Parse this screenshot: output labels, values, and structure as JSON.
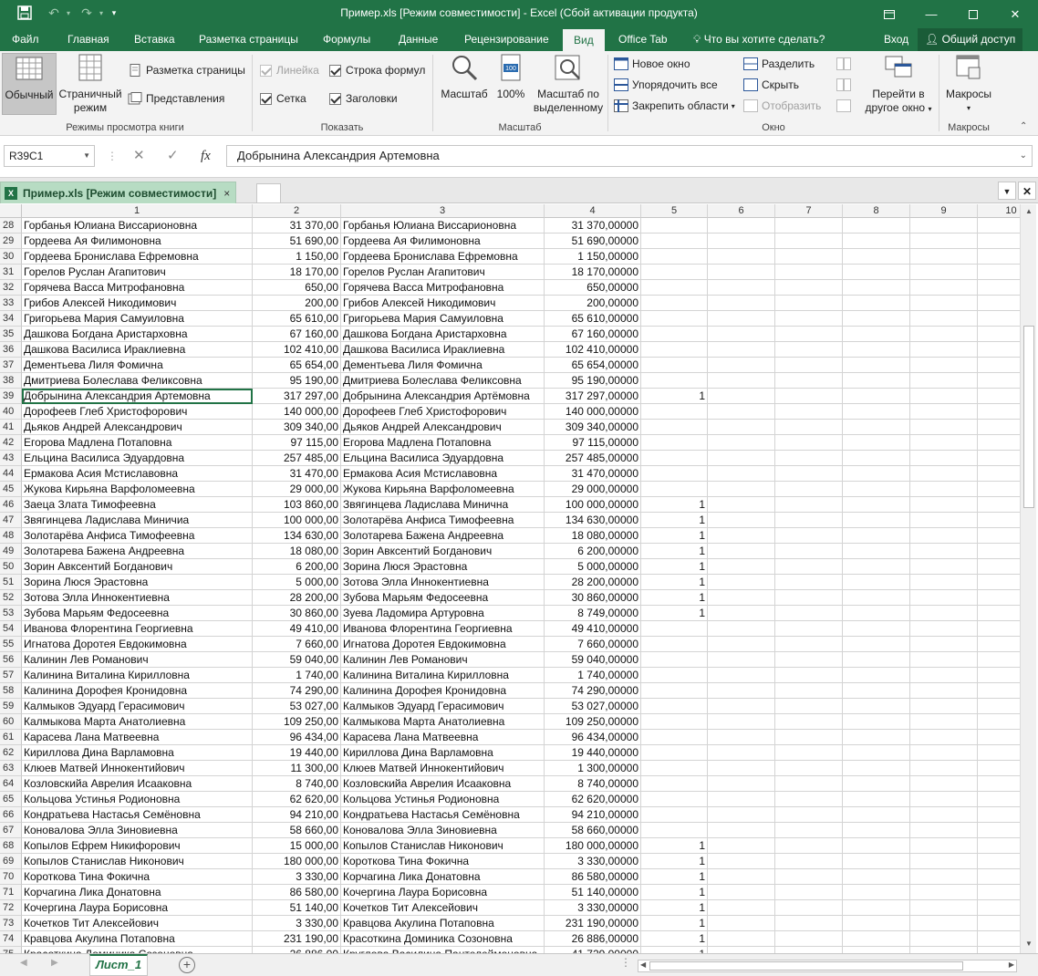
{
  "title_bar": {
    "title": "Пример.xls  [Режим совместимости] - Excel (Сбой активации продукта)",
    "save_icon": "save-icon",
    "undo_icon": "undo-icon",
    "redo_icon": "redo-icon",
    "qat_customize_icon": "chevron-down-icon"
  },
  "ribbon_tabs": {
    "tabs": [
      "Файл",
      "Главная",
      "Вставка",
      "Разметка страницы",
      "Формулы",
      "Данные",
      "Рецензирование",
      "Вид",
      "Office Tab"
    ],
    "active": "Вид",
    "tell_me": "Что вы хотите сделать?",
    "sign_in": "Вход",
    "share": "Общий доступ"
  },
  "ribbon": {
    "view_modes": {
      "normal": "Обычный",
      "page_break_line1": "Страничный",
      "page_break_line2": "режим",
      "page_layout": "Разметка страницы",
      "custom_views": "Представления",
      "group_label": "Режимы просмотра книги"
    },
    "show": {
      "ruler": "Линейка",
      "formula_bar": "Строка формул",
      "gridlines": "Сетка",
      "headings": "Заголовки",
      "group_label": "Показать"
    },
    "zoom": {
      "zoom": "Масштаб",
      "hundred": "100%",
      "zoom_to_sel_line1": "Масштаб по",
      "zoom_to_sel_line2": "выделенному",
      "group_label": "Масштаб"
    },
    "window": {
      "new_window": "Новое окно",
      "arrange_all": "Упорядочить все",
      "freeze_panes": "Закрепить области",
      "split": "Разделить",
      "hide": "Скрыть",
      "unhide": "Отобразить",
      "switch_line1": "Перейти в",
      "switch_line2": "другое окно",
      "group_label": "Окно"
    },
    "macros": {
      "macros": "Макросы",
      "group_label": "Макросы"
    }
  },
  "formula_bar": {
    "name_box": "R39C1",
    "cancel": "✕",
    "enter": "✓",
    "fx": "fx",
    "content": "Добрынина Александрия Артемовна"
  },
  "workbook_tab": {
    "label": "Пример.xls  [Режим совместимости]",
    "close": "×"
  },
  "grid": {
    "columns": [
      "1",
      "2",
      "3",
      "4",
      "5",
      "6",
      "7",
      "8",
      "9",
      "10"
    ],
    "selected_row": "39",
    "rows": [
      {
        "r": "28",
        "c1": "Горбанья Юлиана Виссарионовна",
        "c2": "31 370,00",
        "c3": "Горбанья Юлиана Виссарионовна",
        "c4": "31 370,00000",
        "c5": ""
      },
      {
        "r": "29",
        "c1": "Гордеева Ая Филимоновна",
        "c2": "51 690,00",
        "c3": "Гордеева Ая Филимоновна",
        "c4": "51 690,00000",
        "c5": ""
      },
      {
        "r": "30",
        "c1": "Гордеева Бронислава Ефремовна",
        "c2": "1 150,00",
        "c3": "Гордеева Бронислава Ефремовна",
        "c4": "1 150,00000",
        "c5": ""
      },
      {
        "r": "31",
        "c1": "Горелов Руслан Агапитович",
        "c2": "18 170,00",
        "c3": "Горелов Руслан Агапитович",
        "c4": "18 170,00000",
        "c5": ""
      },
      {
        "r": "32",
        "c1": "Горячева Васса Митрофановна",
        "c2": "650,00",
        "c3": "Горячева Васса Митрофановна",
        "c4": "650,00000",
        "c5": ""
      },
      {
        "r": "33",
        "c1": "Грибов Алексей Никодимович",
        "c2": "200,00",
        "c3": "Грибов Алексей Никодимович",
        "c4": "200,00000",
        "c5": ""
      },
      {
        "r": "34",
        "c1": "Григорьева Мария Самуиловна",
        "c2": "65 610,00",
        "c3": "Григорьева Мария Самуиловна",
        "c4": "65 610,00000",
        "c5": ""
      },
      {
        "r": "35",
        "c1": "Дашкова Богдана Аристарховна",
        "c2": "67 160,00",
        "c3": "Дашкова Богдана Аристарховна",
        "c4": "67 160,00000",
        "c5": ""
      },
      {
        "r": "36",
        "c1": "Дашкова Василиса Ираклиевна",
        "c2": "102 410,00",
        "c3": "Дашкова Василиса Ираклиевна",
        "c4": "102 410,00000",
        "c5": ""
      },
      {
        "r": "37",
        "c1": "Дементьева Лиля Фомична",
        "c2": "65 654,00",
        "c3": "Дементьева Лиля Фомична",
        "c4": "65 654,00000",
        "c5": ""
      },
      {
        "r": "38",
        "c1": "Дмитриева Болеслава Феликсовна",
        "c2": "95 190,00",
        "c3": "Дмитриева Болеслава Феликсовна",
        "c4": "95 190,00000",
        "c5": ""
      },
      {
        "r": "39",
        "c1": "Добрынина Александрия Артемовна",
        "c2": "317 297,00",
        "c3": "Добрынина Александрия Артёмовна",
        "c4": "317 297,00000",
        "c5": "1"
      },
      {
        "r": "40",
        "c1": "Дорофеев Глеб Христофорович",
        "c2": "140 000,00",
        "c3": "Дорофеев Глеб Христофорович",
        "c4": "140 000,00000",
        "c5": ""
      },
      {
        "r": "41",
        "c1": "Дьяков Андрей Александрович",
        "c2": "309 340,00",
        "c3": "Дьяков Андрей Александрович",
        "c4": "309 340,00000",
        "c5": ""
      },
      {
        "r": "42",
        "c1": "Егорова Мадлена Потаповна",
        "c2": "97 115,00",
        "c3": "Егорова Мадлена Потаповна",
        "c4": "97 115,00000",
        "c5": ""
      },
      {
        "r": "43",
        "c1": "Ельцина Василиса Эдуардовна",
        "c2": "257 485,00",
        "c3": "Ельцина Василиса Эдуардовна",
        "c4": "257 485,00000",
        "c5": ""
      },
      {
        "r": "44",
        "c1": "Ермакова Асия Мстиславовна",
        "c2": "31 470,00",
        "c3": "Ермакова Асия Мстиславовна",
        "c4": "31 470,00000",
        "c5": ""
      },
      {
        "r": "45",
        "c1": "Жукова Кирьяна Варфоломеевна",
        "c2": "29 000,00",
        "c3": "Жукова Кирьяна Варфоломеевна",
        "c4": "29 000,00000",
        "c5": ""
      },
      {
        "r": "46",
        "c1": "Заеца Злата Тимофеевна",
        "c2": "103 860,00",
        "c3": "Звягинцева Ладислава Минична",
        "c4": "100 000,00000",
        "c5": "1"
      },
      {
        "r": "47",
        "c1": "Звягинцева Ладислава Миничиа",
        "c2": "100 000,00",
        "c3": "Золотарёва Анфиса Тимофеевна",
        "c4": "134 630,00000",
        "c5": "1"
      },
      {
        "r": "48",
        "c1": "Золотарёва Анфиса Тимофеевна",
        "c2": "134 630,00",
        "c3": "Золотарева Бажена Андреевна",
        "c4": "18 080,00000",
        "c5": "1"
      },
      {
        "r": "49",
        "c1": "Золотарева Бажена Андреевна",
        "c2": "18 080,00",
        "c3": "Зорин Авксентий Богданович",
        "c4": "6 200,00000",
        "c5": "1"
      },
      {
        "r": "50",
        "c1": "Зорин Авксентий Богданович",
        "c2": "6 200,00",
        "c3": "Зорина Люся Эрастовна",
        "c4": "5 000,00000",
        "c5": "1"
      },
      {
        "r": "51",
        "c1": "Зорина Люся Эрастовна",
        "c2": "5 000,00",
        "c3": "Зотова Элла Иннокентиевна",
        "c4": "28 200,00000",
        "c5": "1"
      },
      {
        "r": "52",
        "c1": "Зотова Элла Иннокентиевна",
        "c2": "28 200,00",
        "c3": "Зубова Марьям Федосеевна",
        "c4": "30 860,00000",
        "c5": "1"
      },
      {
        "r": "53",
        "c1": "Зубова Марьям Федосеевна",
        "c2": "30 860,00",
        "c3": "Зуева Ладомира Артуровна",
        "c4": "8 749,00000",
        "c5": "1"
      },
      {
        "r": "54",
        "c1": "Иванова Флорентина Георгиевна",
        "c2": "49 410,00",
        "c3": "Иванова Флорентина Георгиевна",
        "c4": "49 410,00000",
        "c5": ""
      },
      {
        "r": "55",
        "c1": "Игнатова Доротея Евдокимовна",
        "c2": "7 660,00",
        "c3": "Игнатова Доротея Евдокимовна",
        "c4": "7 660,00000",
        "c5": ""
      },
      {
        "r": "56",
        "c1": "Калинин Лев Романович",
        "c2": "59 040,00",
        "c3": "Калинин Лев Романович",
        "c4": "59 040,00000",
        "c5": ""
      },
      {
        "r": "57",
        "c1": "Калинина Виталина Кирилловна",
        "c2": "1 740,00",
        "c3": "Калинина Виталина Кирилловна",
        "c4": "1 740,00000",
        "c5": ""
      },
      {
        "r": "58",
        "c1": "Калинина Дорофея Кронидовна",
        "c2": "74 290,00",
        "c3": "Калинина Дорофея Кронидовна",
        "c4": "74 290,00000",
        "c5": ""
      },
      {
        "r": "59",
        "c1": "Калмыков Эдуард Герасимович",
        "c2": "53 027,00",
        "c3": "Калмыков Эдуард Герасимович",
        "c4": "53 027,00000",
        "c5": ""
      },
      {
        "r": "60",
        "c1": "Калмыкова Марта Анатолиевна",
        "c2": "109 250,00",
        "c3": "Калмыкова Марта Анатолиевна",
        "c4": "109 250,00000",
        "c5": ""
      },
      {
        "r": "61",
        "c1": "Карасева Лана Матвеевна",
        "c2": "96 434,00",
        "c3": "Карасева Лана Матвеевна",
        "c4": "96 434,00000",
        "c5": ""
      },
      {
        "r": "62",
        "c1": "Кириллова Дина Варламовна",
        "c2": "19 440,00",
        "c3": "Кириллова Дина Варламовна",
        "c4": "19 440,00000",
        "c5": ""
      },
      {
        "r": "63",
        "c1": "Клюев Матвей Иннокентийович",
        "c2": "11 300,00",
        "c3": "Клюев Матвей Иннокентийович",
        "c4": "1 300,00000",
        "c5": ""
      },
      {
        "r": "64",
        "c1": "Козловскийа Аврелия Исааковна",
        "c2": "8 740,00",
        "c3": "Козловскийа Аврелия Исааковна",
        "c4": "8 740,00000",
        "c5": ""
      },
      {
        "r": "65",
        "c1": "Кольцова Устинья Родионовна",
        "c2": "62 620,00",
        "c3": "Кольцова Устинья Родионовна",
        "c4": "62 620,00000",
        "c5": ""
      },
      {
        "r": "66",
        "c1": "Кондратьева Настасья Семёновна",
        "c2": "94 210,00",
        "c3": "Кондратьева Настасья Семёновна",
        "c4": "94 210,00000",
        "c5": ""
      },
      {
        "r": "67",
        "c1": "Коновалова Элла Зиновиевна",
        "c2": "58 660,00",
        "c3": "Коновалова Элла Зиновиевна",
        "c4": "58 660,00000",
        "c5": ""
      },
      {
        "r": "68",
        "c1": "Копылов Ефрем Никифорович",
        "c2": "15 000,00",
        "c3": "Копылов Станислав Никонович",
        "c4": "180 000,00000",
        "c5": "1"
      },
      {
        "r": "69",
        "c1": "Копылов Станислав Никонович",
        "c2": "180 000,00",
        "c3": "Короткова Тина Фокична",
        "c4": "3 330,00000",
        "c5": "1"
      },
      {
        "r": "70",
        "c1": "Короткова Тина Фокична",
        "c2": "3 330,00",
        "c3": "Корчагина Лика Донатовна",
        "c4": "86 580,00000",
        "c5": "1"
      },
      {
        "r": "71",
        "c1": "Корчагина Лика Донатовна",
        "c2": "86 580,00",
        "c3": "Кочергина Лаура Борисовна",
        "c4": "51 140,00000",
        "c5": "1"
      },
      {
        "r": "72",
        "c1": "Кочергина Лаура Борисовна",
        "c2": "51 140,00",
        "c3": "Кочетков Тит Алексейович",
        "c4": "3 330,00000",
        "c5": "1"
      },
      {
        "r": "73",
        "c1": "Кочетков Тит Алексейович",
        "c2": "3 330,00",
        "c3": "Кравцова Акулина Потаповна",
        "c4": "231 190,00000",
        "c5": "1"
      },
      {
        "r": "74",
        "c1": "Кравцова Акулина Потаповна",
        "c2": "231 190,00",
        "c3": "Красоткина Доминика Созоновна",
        "c4": "26 886,00000",
        "c5": "1"
      },
      {
        "r": "75",
        "c1": "Красоткина Доминика Созоновна",
        "c2": "26 886,00",
        "c3": "Круглова Василина Пантелеймоновна",
        "c4": "41 729,00000",
        "c5": "1"
      }
    ]
  },
  "sheet_tabs": {
    "active": "Лист_1",
    "add": "+"
  }
}
